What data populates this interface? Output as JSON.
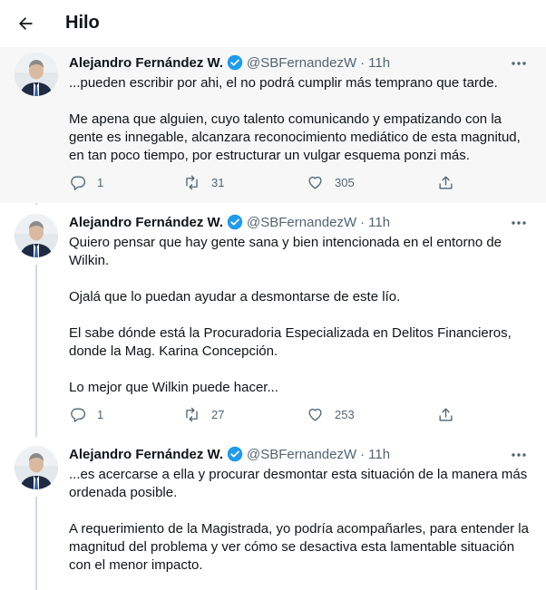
{
  "header": {
    "title": "Hilo"
  },
  "tweets": [
    {
      "author": "Alejandro Fernández W.",
      "handle": "@SBFernandezW",
      "separator": "·",
      "time": "11h",
      "paragraphs": [
        "...pueden escribir por ahi, el no podrá cumplir más temprano que tarde.",
        "Me apena que alguien, cuyo talento comunicando y empatizando con la gente es innegable, alcanzara reconocimiento mediático de esta magnitud, en tan poco tiempo, por estructurar un vulgar esquema ponzi más."
      ],
      "replies": "1",
      "retweets": "31",
      "likes": "305"
    },
    {
      "author": "Alejandro Fernández W.",
      "handle": "@SBFernandezW",
      "separator": "·",
      "time": "11h",
      "paragraphs": [
        "Quiero pensar que hay gente sana y bien intencionada en el entorno de Wilkin.",
        "Ojalá que lo puedan ayudar a desmontarse de este lío.",
        "El sabe dónde está la Procuradoria Especializada en Delitos Financieros, donde la Mag. Karina Concepción.",
        "Lo mejor que Wilkin puede hacer..."
      ],
      "replies": "1",
      "retweets": "27",
      "likes": "253"
    },
    {
      "author": "Alejandro Fernández W.",
      "handle": "@SBFernandezW",
      "separator": "·",
      "time": "11h",
      "paragraphs": [
        "...es acercarse a ella y procurar desmontar esta situación de la manera más ordenada posible.",
        "A requerimiento de la Magistrada, yo podría acompañarles, para entender la magnitud del problema y ver cómo se desactiva esta lamentable situación con el menor impacto."
      ]
    }
  ],
  "icons": {
    "back": "arrow-left-icon",
    "verified": "verified-badge-icon",
    "more": "more-dots-icon",
    "reply": "reply-icon",
    "retweet": "retweet-icon",
    "like": "heart-icon",
    "share": "share-icon"
  },
  "colors": {
    "verified": "#1d9bf0",
    "secondary_text": "#536471",
    "thread_line": "#cfd9de",
    "highlight_bg": "#f7f7f7"
  }
}
